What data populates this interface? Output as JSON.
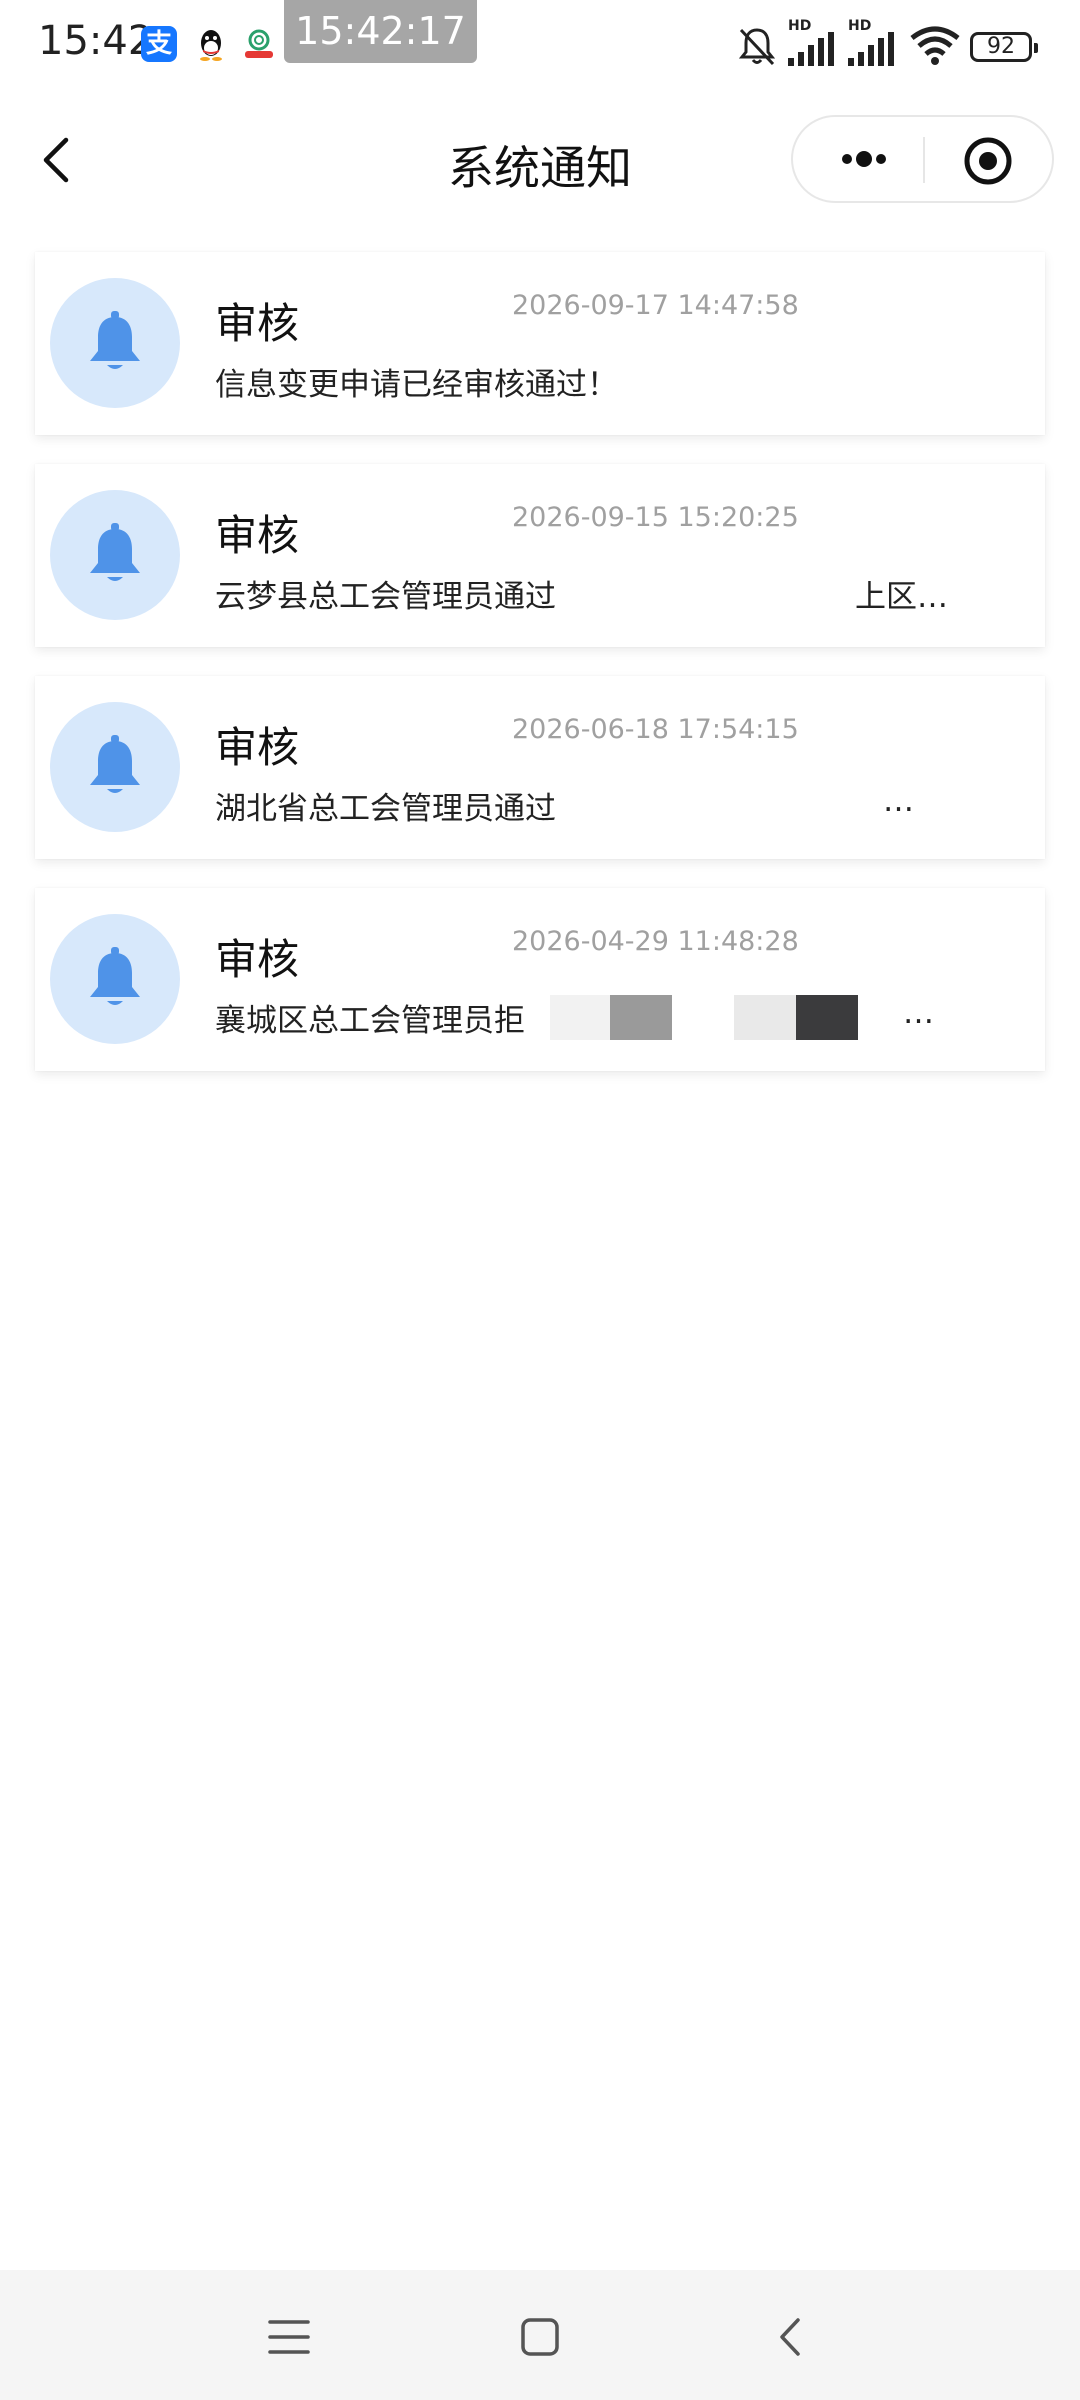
{
  "status_bar": {
    "time": "15:42",
    "overlay_time": "15:42:17",
    "alipay_icon_text": "支",
    "battery": "92",
    "signal_labels": [
      "HD",
      "HD"
    ]
  },
  "nav": {
    "title": "系统通知"
  },
  "notifications": [
    {
      "type": "审核",
      "time": "2026-09-17 14:47:58",
      "message": "信息变更申请已经审核通过！"
    },
    {
      "type": "审核",
      "time": "2026-09-15 15:20:25",
      "message": "云梦县总工会管理员通过",
      "message_tail": "上区…"
    },
    {
      "type": "审核",
      "time": "2026-06-18 17:54:15",
      "message": "湖北省总工会管理员通过",
      "message_tail": "…"
    },
    {
      "type": "审核",
      "time": "2026-04-29 11:48:28",
      "message": "襄城区总工会管理员拒",
      "message_tail": "…"
    }
  ],
  "colors": {
    "bell_bg": "#d7e8fb",
    "bell_fg": "#4f93e8",
    "timestamp": "#a0a0a0"
  },
  "icons": [
    "back-arrow-icon",
    "more-dots-icon",
    "target-circle-icon",
    "bell-icon",
    "menu-lines-icon",
    "home-square-icon",
    "back-chevron-icon"
  ]
}
